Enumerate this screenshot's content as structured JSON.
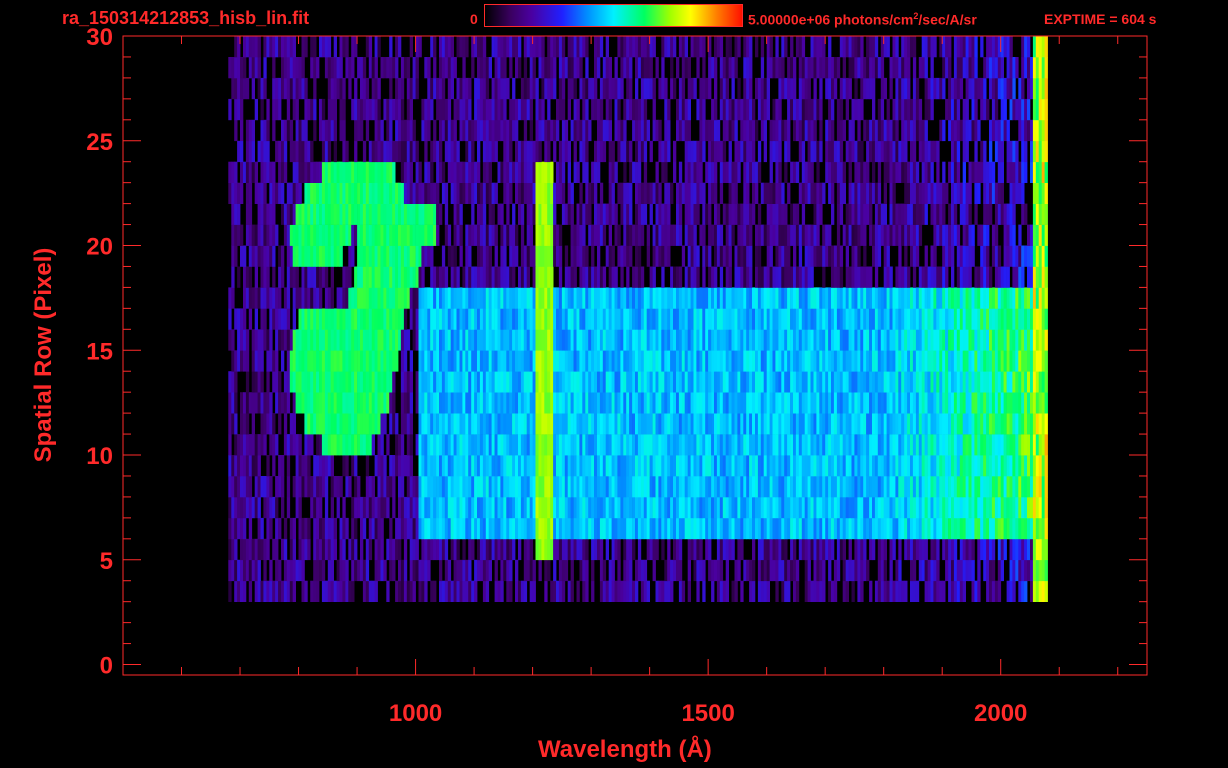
{
  "header": {
    "filename": "ra_150314212853_hisb_lin.fit",
    "colorbar_min": "0",
    "colorbar_max_pre": "5.00000e+06 photons/cm",
    "colorbar_max_sup": "2",
    "colorbar_max_post": "/sec/A/sr",
    "exptime": "EXPTIME = 604 s"
  },
  "colors": {
    "axis": "#ff2a2a",
    "background": "#000000"
  },
  "chart_data": {
    "type": "heatmap",
    "title": "ra_150314212853_hisb_lin.fit",
    "xlabel": "Wavelength (Å)",
    "ylabel": "Spatial Row (Pixel)",
    "xlim": [
      500,
      2250
    ],
    "ylim": [
      -0.5,
      30
    ],
    "xticks": [
      1000,
      1500,
      2000
    ],
    "xtick_labels": [
      "1000",
      "1500",
      "2000"
    ],
    "yticks": [
      0,
      5,
      10,
      15,
      20,
      25,
      30
    ],
    "ytick_labels": [
      "0",
      "5",
      "10",
      "15",
      "20",
      "25",
      "30"
    ],
    "colorbar_range": [
      0,
      5000000
    ],
    "features": [
      {
        "name": "background",
        "x_range": [
          680,
          2080
        ],
        "y_range": [
          3,
          30
        ],
        "level": 0.17
      },
      {
        "name": "continuum",
        "x_range": [
          1000,
          2050
        ],
        "y_range": [
          6,
          18
        ],
        "level": 0.45
      },
      {
        "name": "emission-line",
        "x_center": 1216,
        "y_range": [
          5,
          24
        ],
        "level": 0.72
      },
      {
        "name": "curve",
        "points": [
          [
            840,
            16
          ],
          [
            830,
            14
          ],
          [
            850,
            12
          ],
          [
            880,
            11
          ],
          [
            905,
            13
          ],
          [
            925,
            16
          ],
          [
            945,
            19
          ],
          [
            970,
            21
          ],
          [
            990,
            21
          ]
        ],
        "level": 0.62
      },
      {
        "name": "curve-top",
        "points": [
          [
            830,
            20
          ],
          [
            850,
            22
          ],
          [
            880,
            23
          ],
          [
            920,
            23
          ],
          [
            945,
            21
          ],
          [
            960,
            19
          ]
        ],
        "level": 0.62
      },
      {
        "name": "detector-edge",
        "x_center": 2065,
        "y_range": [
          1,
          30
        ],
        "level": 0.75
      }
    ]
  }
}
